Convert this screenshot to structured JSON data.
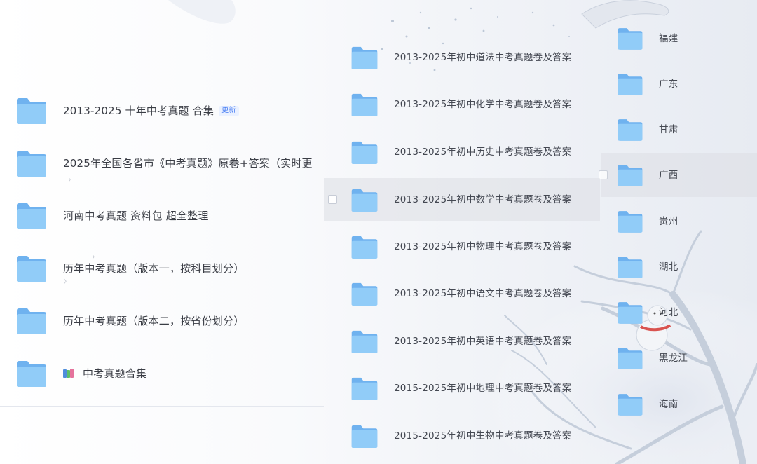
{
  "left_panel": {
    "items": [
      {
        "label": "2013-2025   十年中考真题  合集",
        "badge": "更新",
        "icon": "folder-icon"
      },
      {
        "label": "2025年全国各省市《中考真题》原卷+答案（实时更",
        "icon": "folder-icon"
      },
      {
        "label": "河南中考真题 资料包  超全整理",
        "icon": "folder-icon"
      },
      {
        "label": "历年中考真题（版本一，按科目划分）",
        "icon": "folder-icon"
      },
      {
        "label": "历年中考真题（版本二，按省份划分）",
        "icon": "folder-icon"
      },
      {
        "label": "中考真题合集",
        "icon": "folder-icon",
        "prefix_icon": "books-icon"
      }
    ]
  },
  "middle_panel": {
    "items": [
      {
        "label": "2013-2025年初中道法中考真题卷及答案",
        "icon": "folder-icon"
      },
      {
        "label": "2013-2025年初中化学中考真题卷及答案",
        "icon": "folder-icon"
      },
      {
        "label": "2013-2025年初中历史中考真题卷及答案",
        "icon": "folder-icon"
      },
      {
        "label": "2013-2025年初中数学中考真题卷及答案",
        "icon": "folder-icon",
        "hovered": true
      },
      {
        "label": "2013-2025年初中物理中考真题卷及答案",
        "icon": "folder-icon"
      },
      {
        "label": "2013-2025年初中语文中考真题卷及答案",
        "icon": "folder-icon"
      },
      {
        "label": "2013-2025年初中英语中考真题卷及答案",
        "icon": "folder-icon"
      },
      {
        "label": "2015-2025年初中地理中考真题卷及答案",
        "icon": "folder-icon"
      },
      {
        "label": "2015-2025年初中生物中考真题卷及答案",
        "icon": "folder-icon"
      }
    ]
  },
  "right_panel": {
    "items": [
      {
        "label": "福建",
        "icon": "folder-icon"
      },
      {
        "label": "广东",
        "icon": "folder-icon"
      },
      {
        "label": "甘肃",
        "icon": "folder-icon"
      },
      {
        "label": "广西",
        "icon": "folder-icon",
        "hovered": true
      },
      {
        "label": "贵州",
        "icon": "folder-icon"
      },
      {
        "label": "湖北",
        "icon": "folder-icon"
      },
      {
        "label": "河北",
        "icon": "folder-icon"
      },
      {
        "label": "黑龙江",
        "icon": "folder-icon"
      },
      {
        "label": "海南",
        "icon": "folder-icon"
      }
    ]
  },
  "colors": {
    "folder_front": "#8ec8f6",
    "folder_back": "#6fb2ef",
    "badge_text": "#3b74f2",
    "badge_bg": "#eaf1ff",
    "hover_bg": "#e3e5ea"
  }
}
